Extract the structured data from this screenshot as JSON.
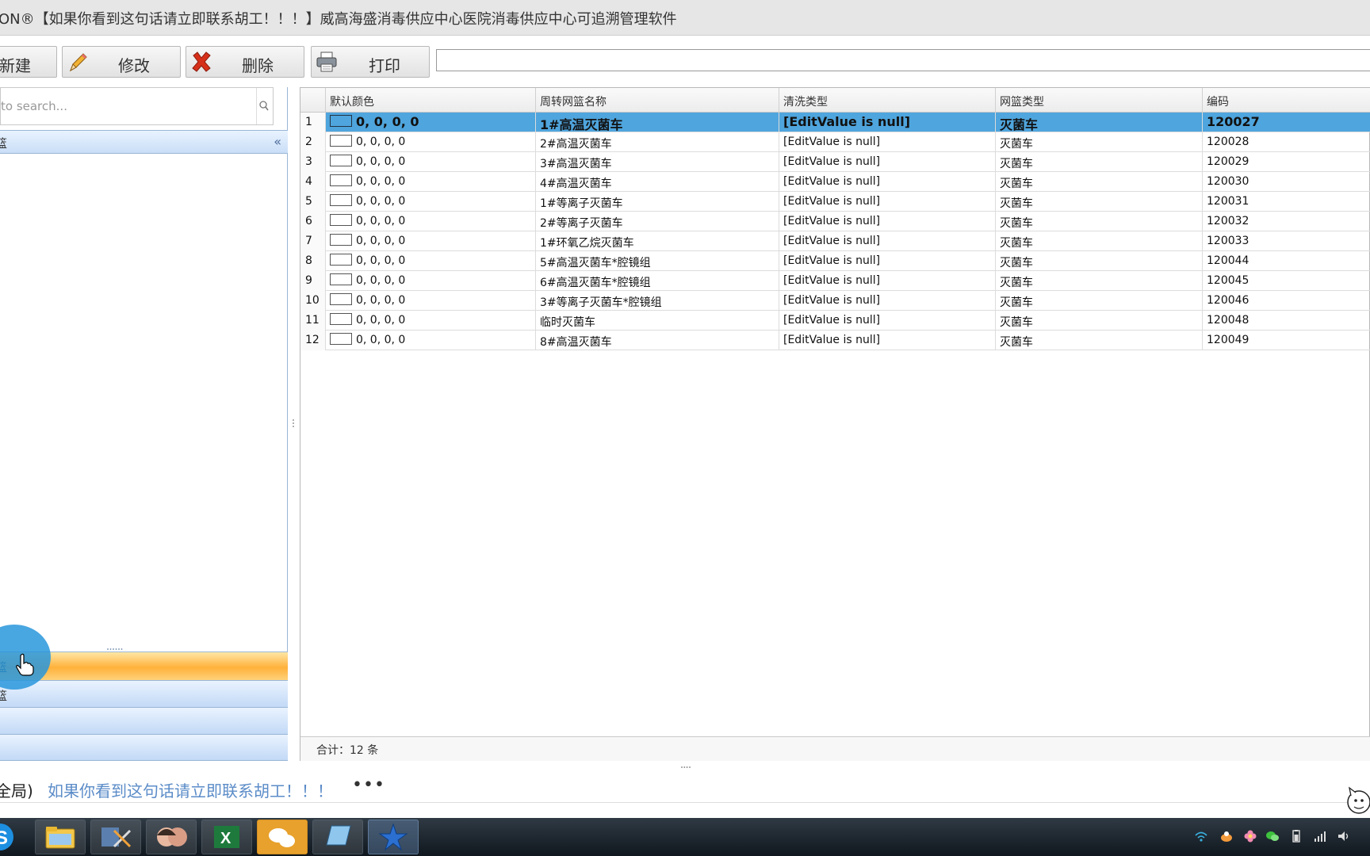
{
  "window": {
    "title": "ON®【如果你看到这句话请立即联系胡工！！！】威高海盛消毒供应中心医院消毒供应中心可追溯管理软件"
  },
  "toolbar": {
    "new_label": "新建",
    "edit_label": "修改",
    "delete_label": "删除",
    "print_label": "打印",
    "input_value": ""
  },
  "sidebar": {
    "search_placeholder": "to search...",
    "group_header": "篮",
    "collapse_glyph": "«",
    "bars": [
      {
        "label": "篮"
      },
      {
        "label": "篮"
      },
      {
        "label": ""
      },
      {
        "label": ""
      }
    ]
  },
  "grid": {
    "columns": [
      "默认颜色",
      "周转网篮名称",
      "清洗类型",
      "网篮类型",
      "编码"
    ],
    "rows": [
      {
        "num": "1",
        "color": "0, 0, 0, 0",
        "name": "1#高温灭菌车",
        "wash": "[EditValue is null]",
        "type": "灭菌车",
        "code": "120027"
      },
      {
        "num": "2",
        "color": "0, 0, 0, 0",
        "name": "2#高温灭菌车",
        "wash": "[EditValue is null]",
        "type": "灭菌车",
        "code": "120028"
      },
      {
        "num": "3",
        "color": "0, 0, 0, 0",
        "name": "3#高温灭菌车",
        "wash": "[EditValue is null]",
        "type": "灭菌车",
        "code": "120029"
      },
      {
        "num": "4",
        "color": "0, 0, 0, 0",
        "name": "4#高温灭菌车",
        "wash": "[EditValue is null]",
        "type": "灭菌车",
        "code": "120030"
      },
      {
        "num": "5",
        "color": "0, 0, 0, 0",
        "name": "1#等离子灭菌车",
        "wash": "[EditValue is null]",
        "type": "灭菌车",
        "code": "120031"
      },
      {
        "num": "6",
        "color": "0, 0, 0, 0",
        "name": "2#等离子灭菌车",
        "wash": "[EditValue is null]",
        "type": "灭菌车",
        "code": "120032"
      },
      {
        "num": "7",
        "color": "0, 0, 0, 0",
        "name": "1#环氧乙烷灭菌车",
        "wash": "[EditValue is null]",
        "type": "灭菌车",
        "code": "120033"
      },
      {
        "num": "8",
        "color": "0, 0, 0, 0",
        "name": "5#高温灭菌车*腔镜组",
        "wash": "[EditValue is null]",
        "type": "灭菌车",
        "code": "120044"
      },
      {
        "num": "9",
        "color": "0, 0, 0, 0",
        "name": "6#高温灭菌车*腔镜组",
        "wash": "[EditValue is null]",
        "type": "灭菌车",
        "code": "120045"
      },
      {
        "num": "10",
        "color": "0, 0, 0, 0",
        "name": "3#等离子灭菌车*腔镜组",
        "wash": "[EditValue is null]",
        "type": "灭菌车",
        "code": "120046"
      },
      {
        "num": "11",
        "color": "0, 0, 0, 0",
        "name": "临时灭菌车",
        "wash": "[EditValue is null]",
        "type": "灭菌车",
        "code": "120048"
      },
      {
        "num": "12",
        "color": "0, 0, 0, 0",
        "name": "8#高温灭菌车",
        "wash": "[EditValue is null]",
        "type": "灭菌车",
        "code": "120049"
      }
    ],
    "selected_row": "1",
    "footer": "合计：12 条"
  },
  "status": {
    "scope": "全局)",
    "message": "如果你看到这句话请立即联系胡工！！！",
    "more": "•••"
  },
  "colors": {
    "selected_row": "#4fa5dd",
    "nav_active": "#ffb13b",
    "nav_header": "#c9def7",
    "status_link": "#5b8cc8"
  },
  "taskbar": {
    "items": [
      "sogou-input-icon",
      "file-explorer-icon",
      "tools-icon",
      "photo-app-icon",
      "excel-icon",
      "wechat-icon",
      "notepad-icon",
      "star-app-icon"
    ],
    "tray": [
      "wifi-icon",
      "ime-icon",
      "flower-icon",
      "wechat-tray-icon",
      "battery-icon",
      "signal-icon",
      "volume-icon"
    ]
  }
}
